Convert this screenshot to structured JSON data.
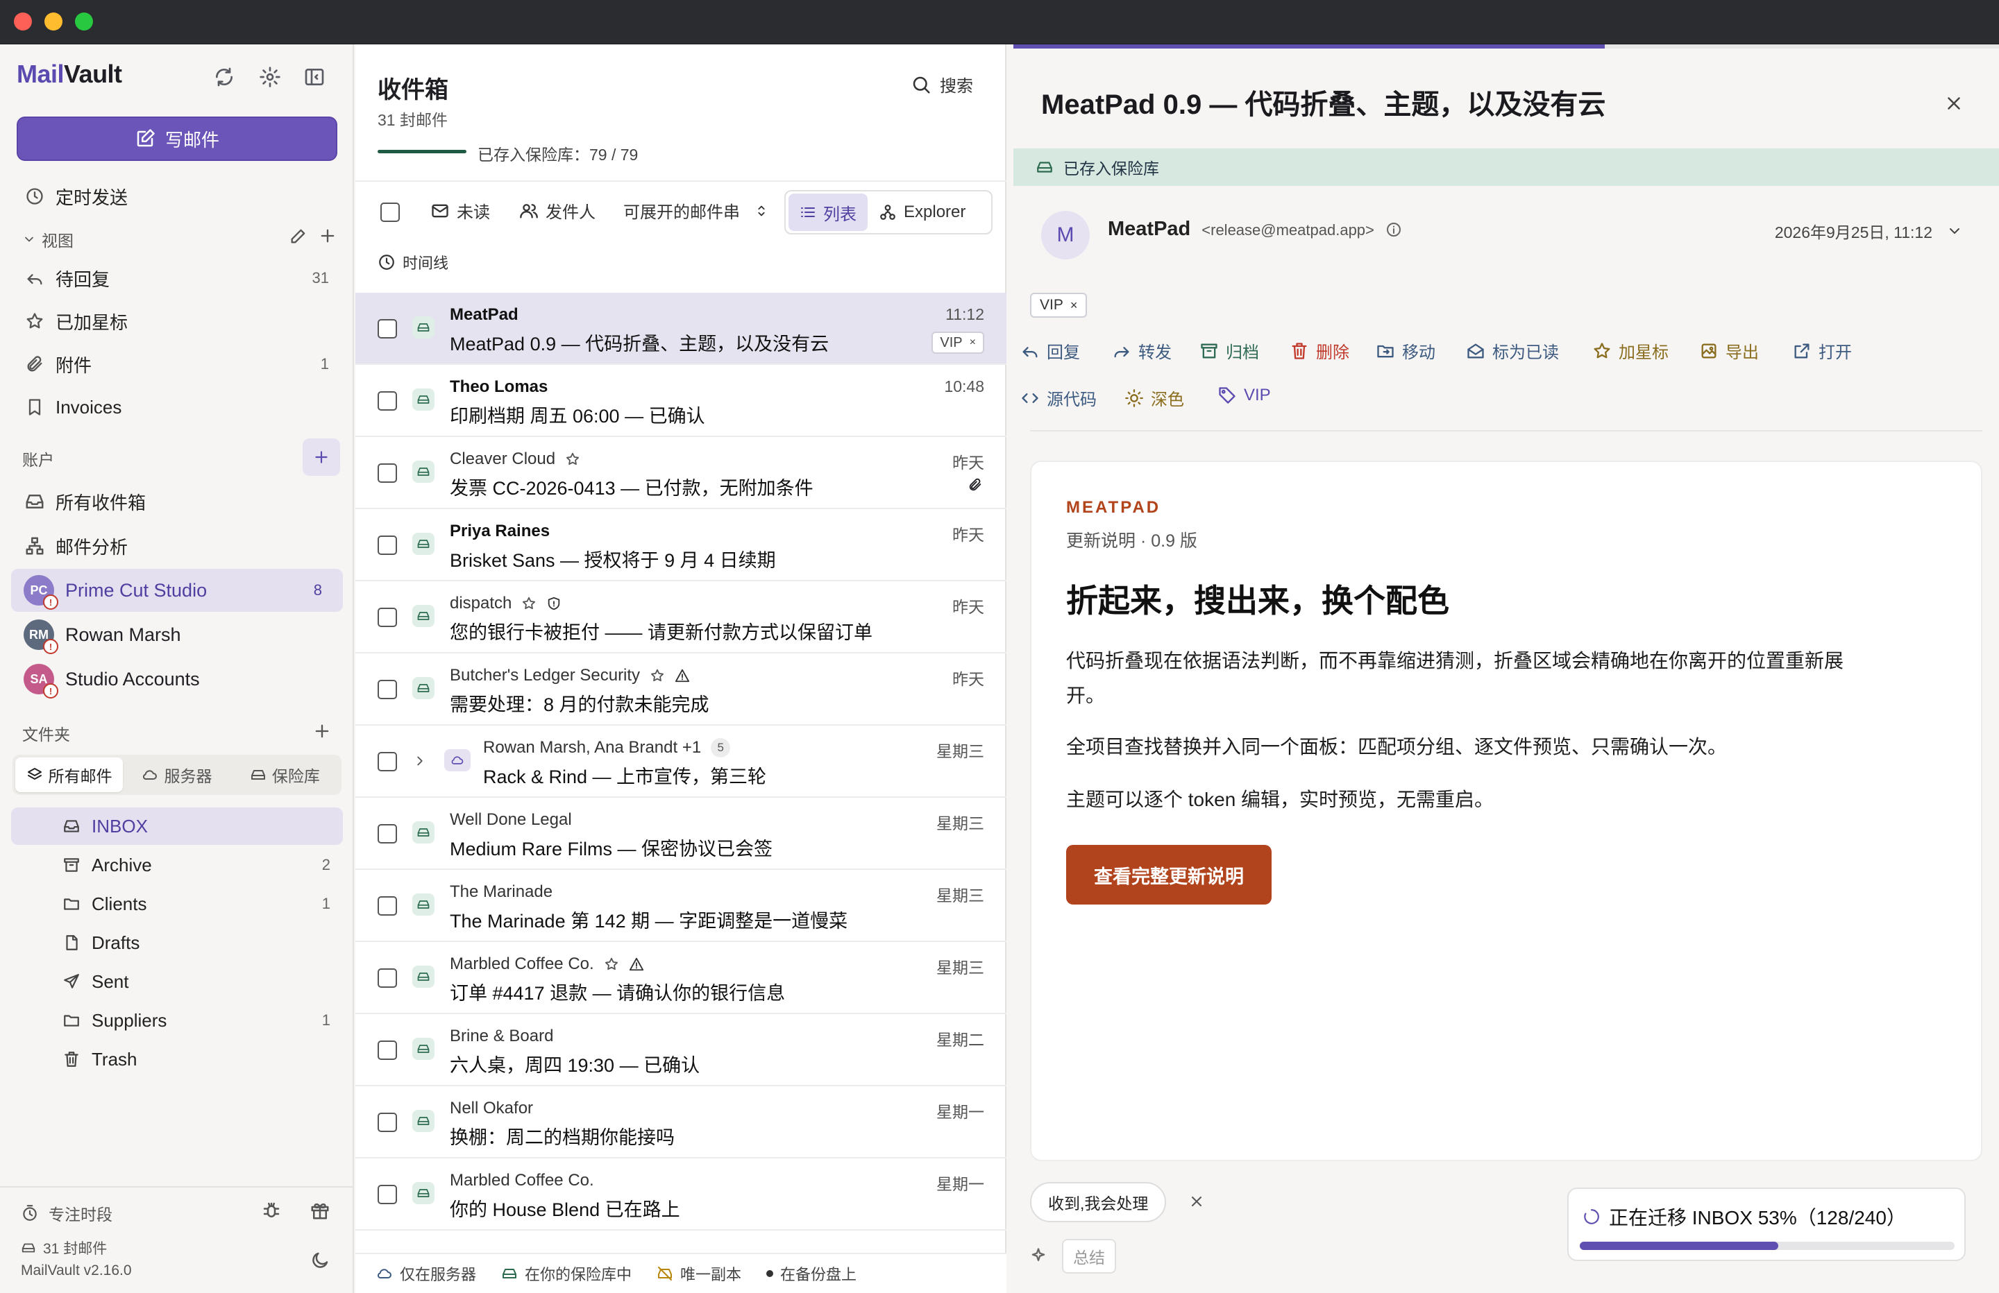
{
  "app": {
    "brand_a": "Mail",
    "brand_b": "Vault",
    "compose": "写邮件"
  },
  "sidebar": {
    "scheduled": "定时发送",
    "views_label": "视图",
    "views": [
      {
        "label": "待回复",
        "count": "31",
        "icon": "reply-icon"
      },
      {
        "label": "已加星标",
        "count": "",
        "icon": "star-icon"
      },
      {
        "label": "附件",
        "count": "1",
        "icon": "paperclip-icon"
      },
      {
        "label": "Invoices",
        "count": "",
        "icon": "bookmark-icon"
      }
    ],
    "accounts_label": "账户",
    "accounts_links": [
      {
        "label": "所有收件箱",
        "icon": "inbox-icon"
      },
      {
        "label": "邮件分析",
        "icon": "graph-icon"
      }
    ],
    "accounts": [
      {
        "label": "Prime Cut Studio",
        "initials": "PC",
        "count": "8",
        "color": "#8b7bc8"
      },
      {
        "label": "Rowan Marsh",
        "initials": "RM",
        "count": "",
        "color": "#5d6a7e"
      },
      {
        "label": "Studio Accounts",
        "initials": "SA",
        "count": "",
        "color": "#c45a8a"
      }
    ],
    "folders_label": "文件夹",
    "folder_tabs": [
      "所有邮件",
      "服务器",
      "保险库"
    ],
    "folders": [
      {
        "label": "INBOX",
        "count": "",
        "icon": "inbox-icon"
      },
      {
        "label": "Archive",
        "count": "2",
        "icon": "archive-icon"
      },
      {
        "label": "Clients",
        "count": "1",
        "icon": "folder-icon"
      },
      {
        "label": "Drafts",
        "count": "",
        "icon": "draft-icon"
      },
      {
        "label": "Sent",
        "count": "",
        "icon": "send-icon"
      },
      {
        "label": "Suppliers",
        "count": "1",
        "icon": "folder-icon"
      },
      {
        "label": "Trash",
        "count": "",
        "icon": "trash-icon"
      }
    ],
    "focus": "专注时段",
    "mail_count": "31 封邮件",
    "version": "MailVault v2.16.0"
  },
  "list": {
    "title": "收件箱",
    "subtitle": "31 封邮件",
    "search": "搜索",
    "vault_progress": "已存入保险库：79 / 79",
    "vault_fraction": 1.0,
    "filters": {
      "unread": "未读",
      "sender": "发件人",
      "threads": "可展开的邮件串",
      "list": "列表",
      "explorer": "Explorer",
      "timeline": "时间线"
    },
    "rows": [
      {
        "sender": "MeatPad",
        "subject": "MeatPad 0.9 — 代码折叠、主题，以及没有云",
        "time": "11:12",
        "tag": "VIP",
        "bold": true,
        "selected": true
      },
      {
        "sender": "Theo Lomas",
        "subject": "印刷档期 周五 06:00 — 已确认",
        "time": "10:48",
        "bold": true
      },
      {
        "sender": "Cleaver Cloud",
        "subject": "发票 CC-2026-0413 — 已付款，无附加条件",
        "time": "昨天",
        "star": true,
        "attach": true
      },
      {
        "sender": "Priya Raines",
        "subject": "Brisket Sans — 授权将于 9 月 4 日续期",
        "time": "昨天",
        "bold": true
      },
      {
        "sender": "dispatch",
        "subject": "您的银行卡被拒付 —— 请更新付款方式以保留订单",
        "time": "昨天",
        "star": true,
        "shield": true
      },
      {
        "sender": "Butcher's Ledger Security",
        "subject": "需要处理：8 月的付款未能完成",
        "time": "昨天",
        "star": true,
        "warn": true
      },
      {
        "sender": "Rowan Marsh, Ana Brandt +1",
        "subject": "Rack & Rind — 上市宣传，第三轮",
        "time": "星期三",
        "thread": "5"
      },
      {
        "sender": "Well Done Legal",
        "subject": "Medium Rare Films — 保密协议已会签",
        "time": "星期三"
      },
      {
        "sender": "The Marinade",
        "subject": "The Marinade 第 142 期 — 字距调整是一道慢菜",
        "time": "星期三"
      },
      {
        "sender": "Marbled Coffee Co.",
        "subject": "订单 #4417 退款 — 请确认你的银行信息",
        "time": "星期三",
        "star": true,
        "warn": true
      },
      {
        "sender": "Brine & Board",
        "subject": "六人桌，周四 19:30 — 已确认",
        "time": "星期二"
      },
      {
        "sender": "Nell Okafor",
        "subject": "换棚：周二的档期你能接吗",
        "time": "星期一"
      },
      {
        "sender": "Marbled Coffee Co.",
        "subject": "你的 House Blend 已在路上",
        "time": "星期一"
      }
    ],
    "footer": [
      "仅在服务器",
      "在你的保险库中",
      "唯一副本",
      "在备份盘上"
    ]
  },
  "reader": {
    "title": "MeatPad 0.9 — 代码折叠、主题，以及没有云",
    "vault_banner": "已存入保险库",
    "from_name": "MeatPad",
    "from_email": "<release@meatpad.app>",
    "avatar": "M",
    "date": "2026年9月25日, 11:12",
    "tag": "VIP",
    "actions": [
      {
        "label": "回复",
        "icon": "reply-icon",
        "color": "#3d5a80"
      },
      {
        "label": "转发",
        "icon": "forward-icon",
        "color": "#3d5a80"
      },
      {
        "label": "归档",
        "icon": "archive-icon",
        "color": "#2f6a55"
      },
      {
        "label": "删除",
        "icon": "trash-icon",
        "color": "#c0392b"
      },
      {
        "label": "移动",
        "icon": "move-icon",
        "color": "#3d5a80"
      },
      {
        "label": "标为已读",
        "icon": "mail-open-icon",
        "color": "#3d5a80"
      },
      {
        "label": "加星标",
        "icon": "star-icon",
        "color": "#8a6d1e"
      },
      {
        "label": "导出",
        "icon": "export-icon",
        "color": "#8a6d1e"
      },
      {
        "label": "打开",
        "icon": "external-icon",
        "color": "#3d5a80"
      },
      {
        "label": "源代码",
        "icon": "code-icon",
        "color": "#3d5a80"
      },
      {
        "label": "深色",
        "icon": "sun-icon",
        "color": "#8a6d1e"
      },
      {
        "label": "VIP",
        "icon": "tag-icon",
        "color": "#5b4bb0"
      }
    ],
    "body": {
      "brand": "MEATPAD",
      "sub": "更新说明 · 0.9 版",
      "heading": "折起来，搜出来，换个配色",
      "p1": "代码折叠现在依据语法判断，而不再靠缩进猜测，折叠区域会精确地在你离开的位置重新展开。",
      "p2": "全项目查找替换并入同一个面板：匹配项分组、逐文件预览、只需确认一次。",
      "p3": "主题可以逐个 token 编辑，实时预览，无需重启。",
      "cta": "查看完整更新说明"
    },
    "quick_reply": "收到,我会处理",
    "summarize": "总结",
    "migration": "正在迁移 INBOX 53%（128/240）",
    "migration_fraction": 0.53,
    "reading_progress": 0.6
  }
}
